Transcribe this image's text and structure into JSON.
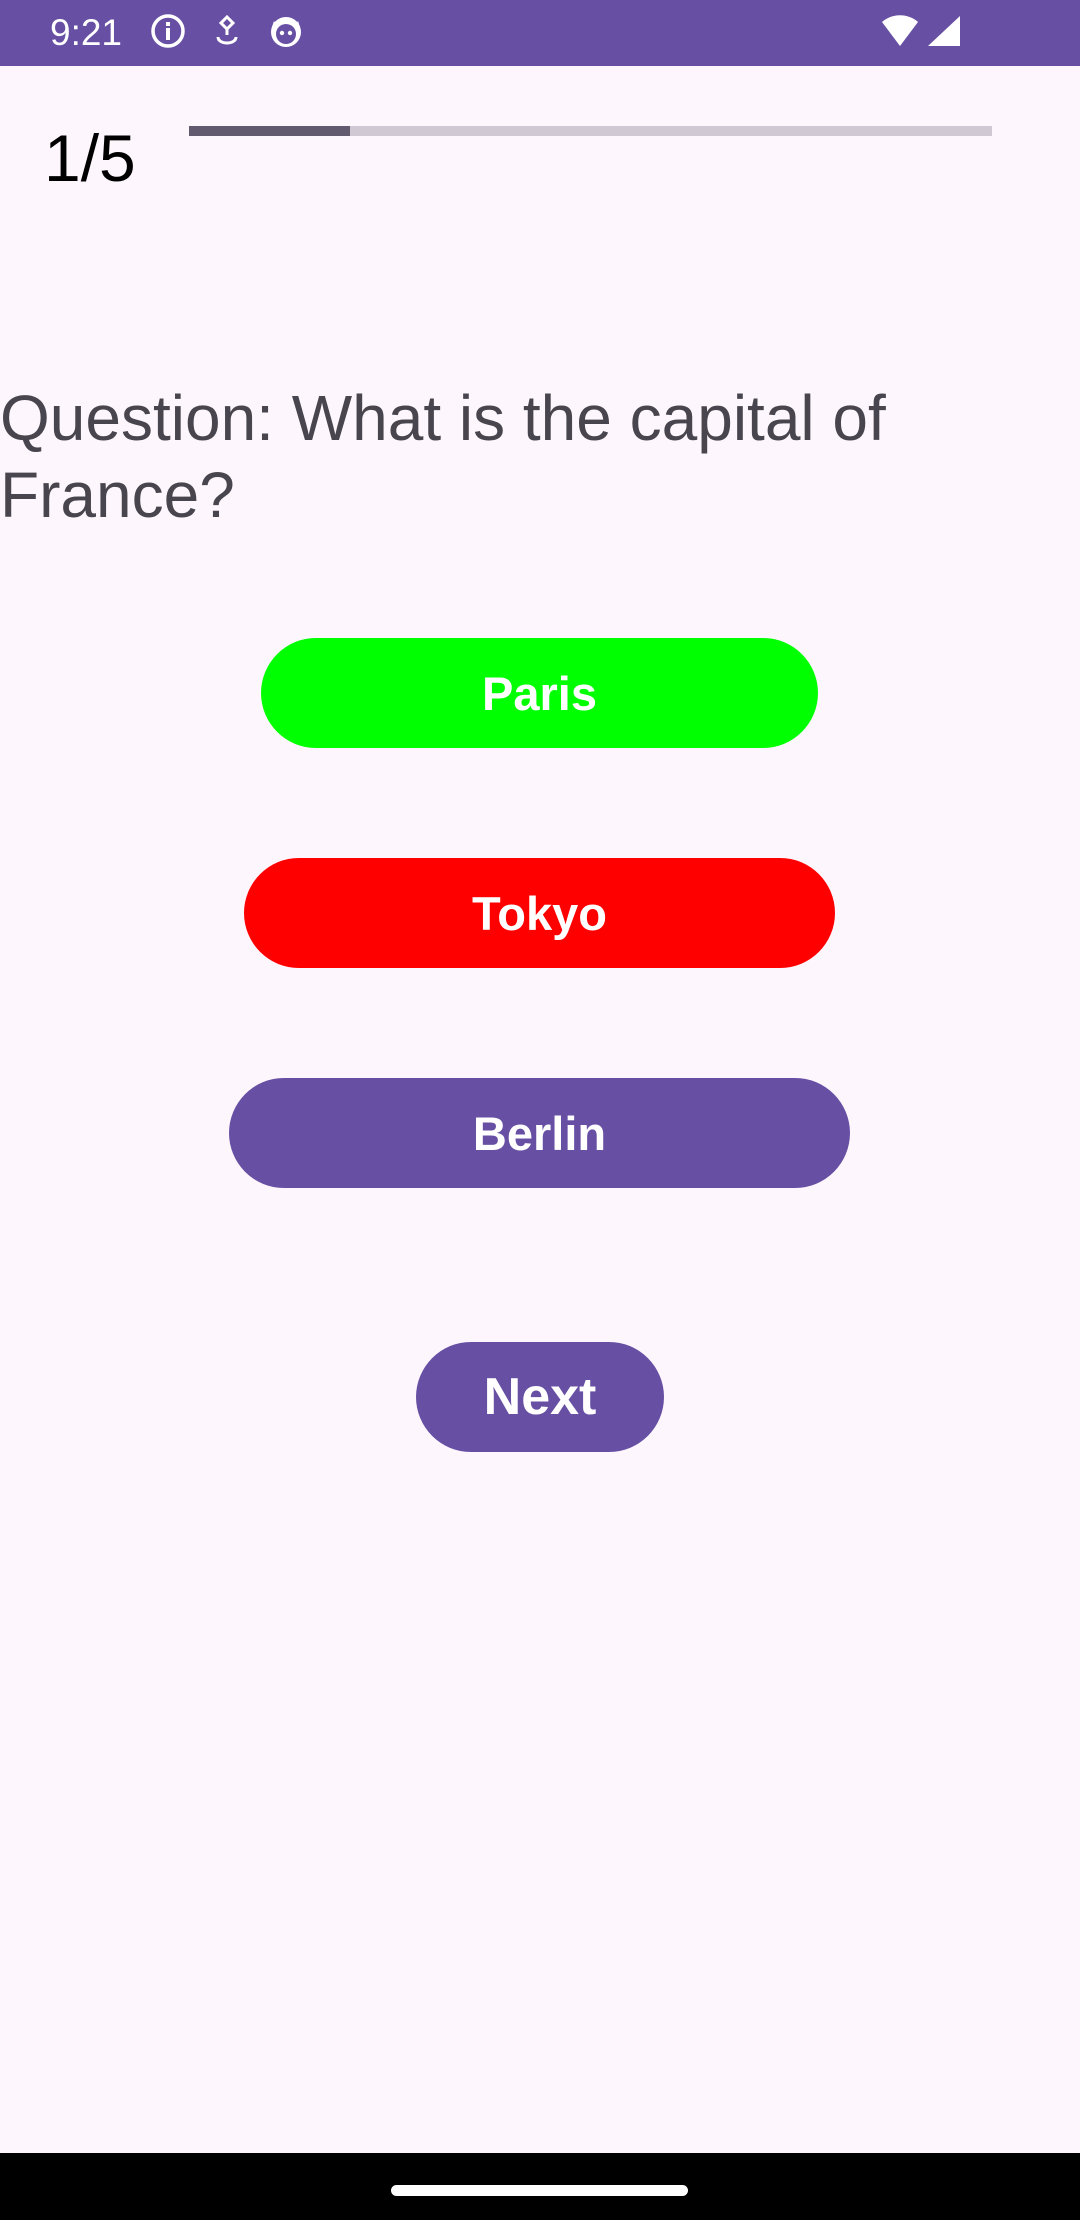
{
  "status_bar": {
    "time": "9:21",
    "left_icons": [
      "info-icon",
      "location-icon",
      "cat-face-icon"
    ],
    "right_icons": [
      "wifi-icon",
      "cell-signal-icon"
    ],
    "background": "#6750a4"
  },
  "quiz": {
    "counter": "1/5",
    "progress_fraction": 0.2,
    "question": "Question: What is the capital of France?",
    "answers": [
      {
        "label": "Paris",
        "color": "#00ff00"
      },
      {
        "label": "Tokyo",
        "color": "#ff0000"
      },
      {
        "label": "Berlin",
        "color": "#6750a4"
      }
    ],
    "next_label": "Next",
    "next_color": "#6750a4"
  }
}
